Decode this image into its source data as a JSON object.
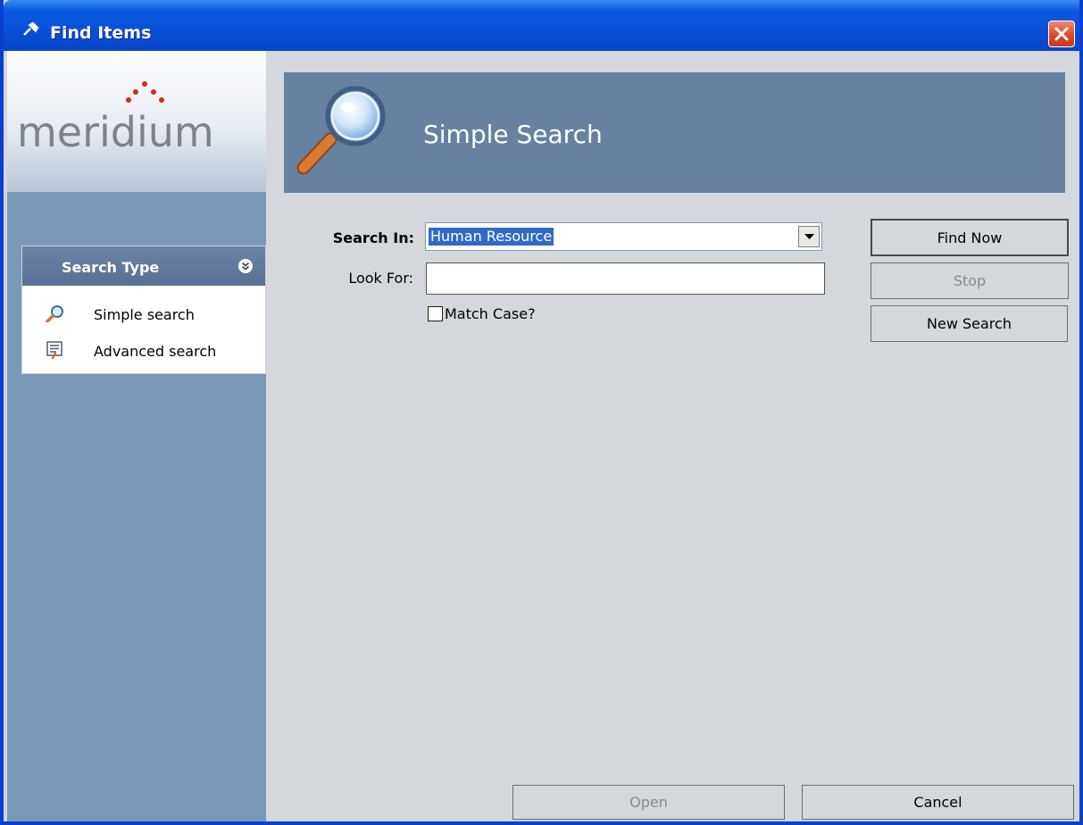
{
  "window": {
    "title": "Find Items"
  },
  "sidebar": {
    "logo_text": "meridium",
    "panel_title": "Search Type",
    "items": [
      {
        "label": "Simple search",
        "icon": "magnifier-icon"
      },
      {
        "label": "Advanced search",
        "icon": "advanced-search-icon"
      }
    ]
  },
  "main": {
    "banner_title": "Simple Search",
    "search_in_label": "Search In:",
    "search_in_value": "Human Resource",
    "look_for_label": "Look For:",
    "look_for_value": "",
    "match_case_label": "Match Case?",
    "match_case_checked": false
  },
  "buttons": {
    "find_now": "Find Now",
    "stop": "Stop",
    "new_search": "New Search",
    "open": "Open",
    "cancel": "Cancel"
  },
  "colors": {
    "titlebar": "#0a4fd8",
    "sidebar": "#7a98b8",
    "banner": "#6781a1",
    "panel_header": "#566f93",
    "logo_dots": "#d8261a",
    "selection": "#316ac5",
    "close_button": "#d74825"
  }
}
